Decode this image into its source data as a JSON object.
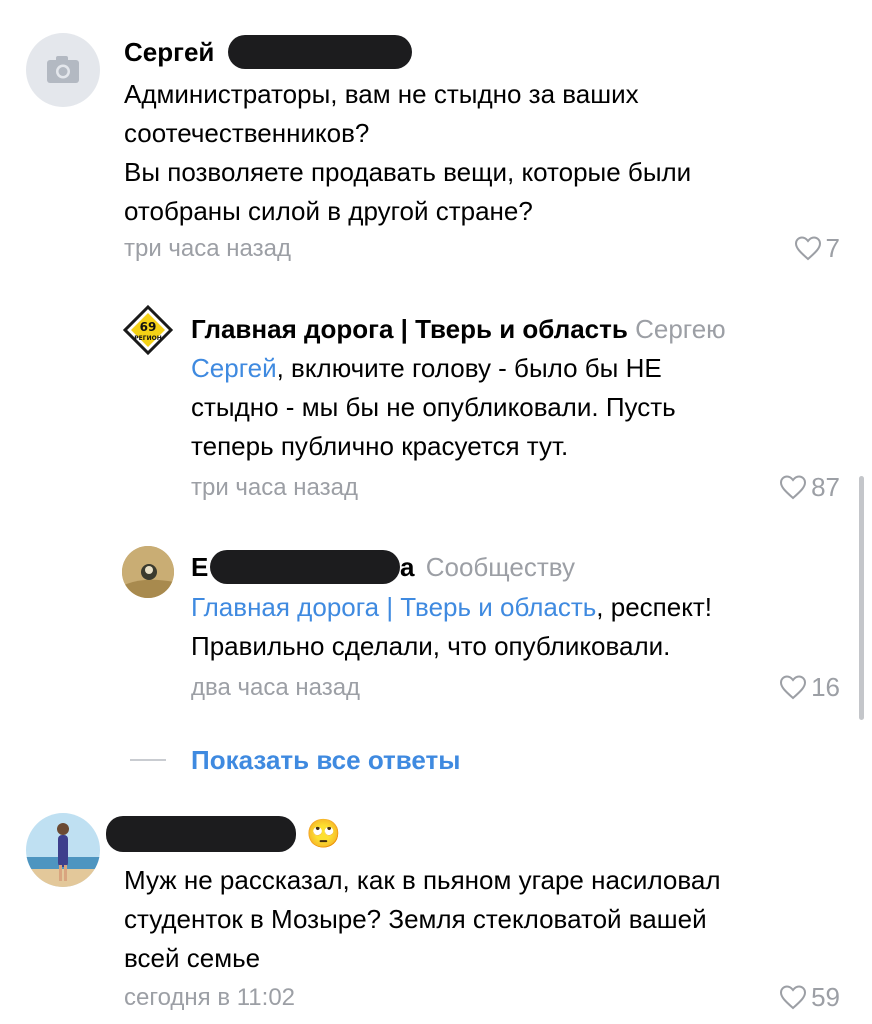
{
  "comments": [
    {
      "name_visible": "Сергей",
      "text_lines": [
        "Администраторы, вам не стыдно за ваших",
        "соотечественников?",
        "Вы позволяете продавать вещи, которые были",
        "отобраны силой в другой стране?"
      ],
      "time": "три часа назад",
      "likes": "7"
    }
  ],
  "replies": [
    {
      "name": "Главная дорога | Тверь и область",
      "to": "Сергею",
      "mention": "Сергей",
      "text_after_mention": ", включите голову - было бы НЕ",
      "text_lines": [
        "стыдно - мы бы не опубликовали. Пусть",
        "теперь публично красуется тут."
      ],
      "time": "три часа назад",
      "likes": "87",
      "logo_text": "69",
      "logo_subtext": "РЕГИОН"
    },
    {
      "name_start": "Е",
      "name_end": "а",
      "to": "Сообществу",
      "mention": "Главная дорога | Тверь и область",
      "text_after_mention": ", респект!",
      "text_lines": [
        "Правильно сделали, что опубликовали."
      ],
      "time": "два часа назад",
      "likes": "16"
    }
  ],
  "show_all_replies": "Показать все ответы",
  "last_comment": {
    "emoji": "🙄",
    "text_lines": [
      "Муж не рассказал, как в пьяном угаре насиловал",
      "студенток в Мозыре? Земля стекловатой вашей",
      "всей семье"
    ],
    "time": "сегодня в 11:02",
    "likes": "59"
  },
  "colors": {
    "link": "#3f8ae0",
    "muted": "#9c9fa5"
  }
}
